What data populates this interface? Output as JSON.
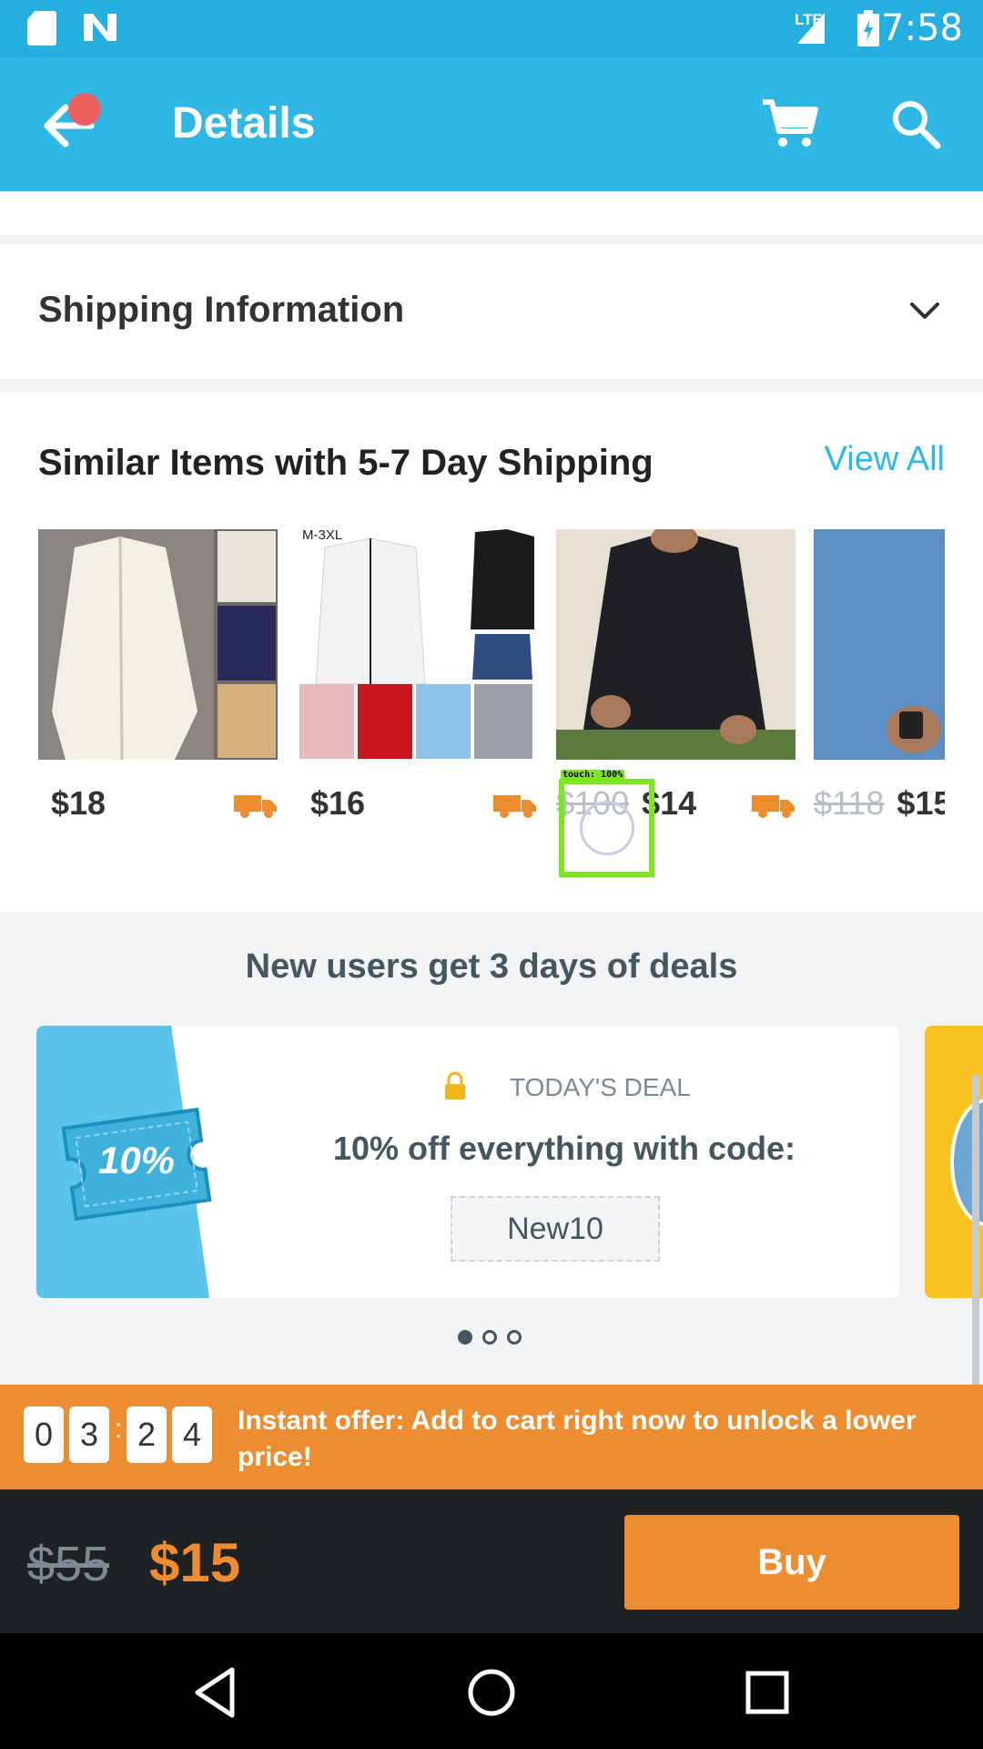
{
  "status_bar": {
    "time": "7:58",
    "network": "LTE"
  },
  "header": {
    "title": "Details"
  },
  "shipping": {
    "title": "Shipping Information"
  },
  "similar": {
    "title": "Similar Items with 5-7 Day Shipping",
    "view_all": "View All",
    "products": [
      {
        "price": "$18",
        "old_price": "",
        "image": "white-linen-shirt",
        "shipping_icon": "truck-icon"
      },
      {
        "price": "$16",
        "old_price": "",
        "image": "blazer-color-grid",
        "size_label": "M-3XL",
        "shipping_icon": "truck-icon"
      },
      {
        "price": "$14",
        "old_price": "$100",
        "image": "black-striped-shirt",
        "shipping_icon": "truck-icon"
      },
      {
        "price": "$15",
        "old_price": "$118",
        "image": "blue-henley-shirt"
      }
    ]
  },
  "touch_overlay": {
    "label": "touch: 100%"
  },
  "deals": {
    "title": "New users get 3 days of deals",
    "badge": "TODAY'S DEAL",
    "coupon_text": "10%",
    "text": "10% off everything with code:",
    "code": "New10",
    "pages": 3,
    "active_page": 0
  },
  "offer": {
    "timer": [
      "0",
      "3",
      "2",
      "4"
    ],
    "separator": ":",
    "text": "Instant offer: Add to cart right now to unlock a lower price!"
  },
  "checkout": {
    "old_price": "$55",
    "price": "$15",
    "buy_label": "Buy"
  },
  "colors": {
    "primary": "#2fb8e6",
    "accent": "#ee8c30",
    "dark": "#1e2225",
    "badge": "#ee5f60"
  }
}
